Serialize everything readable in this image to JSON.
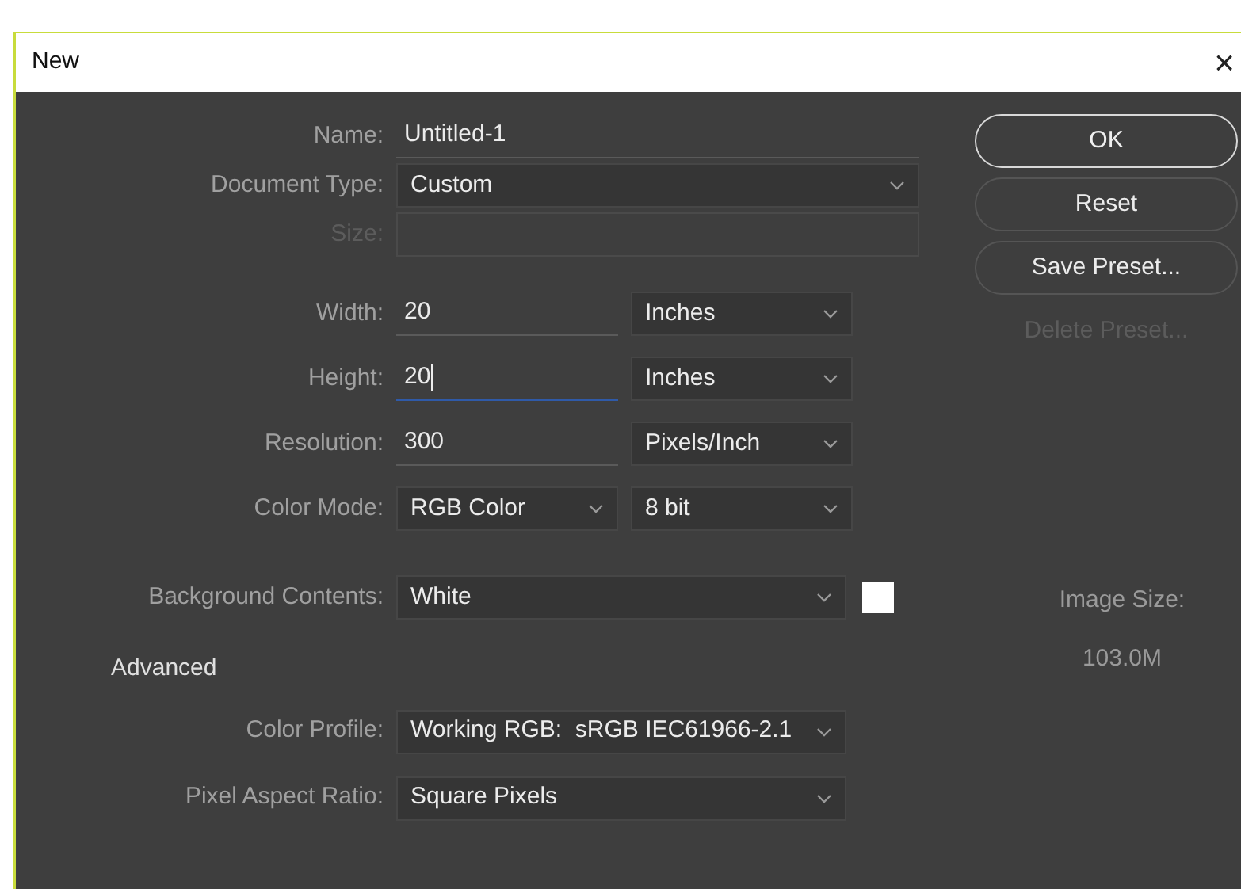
{
  "window": {
    "title": "New",
    "close": "×"
  },
  "sections": [
    {
      "rows": [
        {
          "label": "Name:",
          "disabled": false,
          "controls": [
            {
              "kind": "input",
              "value": "Untitled-1",
              "focused": false
            }
          ]
        },
        {
          "label": "Document Type:",
          "disabled": false,
          "controls": [
            {
              "kind": "select",
              "value": "Custom"
            }
          ]
        },
        {
          "label": "Size:",
          "disabled": true,
          "controls": [
            {
              "kind": "box"
            }
          ]
        }
      ]
    },
    {
      "rows": [
        {
          "label": "Width:",
          "disabled": false,
          "controls": [
            {
              "kind": "input",
              "value": "20",
              "focused": false
            },
            {
              "kind": "select",
              "value": "Inches"
            }
          ]
        },
        {
          "label": "Height:",
          "disabled": false,
          "controls": [
            {
              "kind": "input",
              "value": "20",
              "focused": true
            },
            {
              "kind": "select",
              "value": "Inches"
            }
          ]
        },
        {
          "label": "Resolution:",
          "disabled": false,
          "controls": [
            {
              "kind": "input",
              "value": "300",
              "focused": false
            },
            {
              "kind": "select",
              "value": "Pixels/Inch"
            }
          ]
        },
        {
          "label": "Color Mode:",
          "disabled": false,
          "controls": [
            {
              "kind": "select",
              "value": "RGB Color"
            },
            {
              "kind": "select",
              "value": "8 bit"
            }
          ]
        }
      ]
    },
    {
      "rows": [
        {
          "label": "Background Contents:",
          "disabled": false,
          "controls": [
            {
              "kind": "select",
              "value": "White"
            },
            {
              "kind": "swatch",
              "color": "#ffffff"
            }
          ]
        }
      ]
    },
    {
      "title": "Advanced",
      "rows": [
        {
          "label": "Color Profile:",
          "disabled": false,
          "controls": [
            {
              "kind": "select",
              "value": "Working RGB:  sRGB IEC61966-2.1"
            }
          ]
        },
        {
          "label": "Pixel Aspect Ratio:",
          "disabled": false,
          "controls": [
            {
              "kind": "select",
              "value": "Square Pixels"
            }
          ]
        }
      ]
    }
  ],
  "buttons": [
    {
      "label": "OK",
      "default": true,
      "disabled": false
    },
    {
      "label": "Reset",
      "default": false,
      "disabled": false
    },
    {
      "label": "Save Preset...",
      "default": false,
      "disabled": false
    },
    {
      "label": "Delete Preset...",
      "default": false,
      "disabled": true
    }
  ],
  "image_size": {
    "label": "Image Size:",
    "value": "103.0M"
  }
}
